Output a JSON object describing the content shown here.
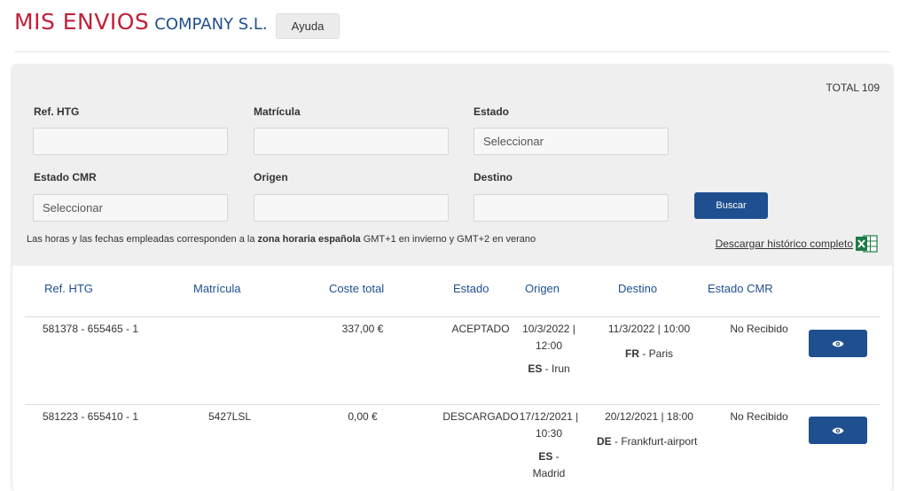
{
  "header": {
    "brand_main": "MIS ENVIOS",
    "brand_sub": "COMPANY S.L.",
    "help_label": "Ayuda"
  },
  "filters": {
    "total": "TOTAL 109",
    "ref_label": "Ref. HTG",
    "ref_value": "",
    "matricula_label": "Matrícula",
    "matricula_value": "",
    "estado_label": "Estado",
    "estado_value": "Seleccionar",
    "estado_cmr_label": "Estado CMR",
    "estado_cmr_value": "Seleccionar",
    "origen_label": "Origen",
    "origen_value": "",
    "destino_label": "Destino",
    "destino_value": "",
    "search_label": "Buscar",
    "note_prefix": "Las horas y las fechas empleadas corresponden a la ",
    "note_bold": "zona horaria española",
    "note_suffix": " GMT+1 en invierno y GMT+2 en verano",
    "download_label": "Descargar histórico completo"
  },
  "table": {
    "columns": [
      "Ref. HTG",
      "Matrícula",
      "Coste total",
      "Estado",
      "Origen",
      "Destino",
      "Estado CMR"
    ],
    "rows": [
      {
        "ref": "581378 - 655465 - 1",
        "matricula": "",
        "coste": "337,00 €",
        "estado": "ACEPTADO",
        "origen_date": "10/3/2022 |",
        "origen_time": "12:00",
        "origen_country": "ES",
        "origen_city": " - Irun",
        "destino_datetime": "11/3/2022 | 10:00",
        "destino_country": "FR",
        "destino_city": " - Paris",
        "cmr": "No Recibido"
      },
      {
        "ref": "581223 - 655410 - 1",
        "matricula": "5427LSL",
        "coste": "0,00 €",
        "estado": "DESCARGADO",
        "origen_date": "17/12/2021 |",
        "origen_time": "10:30",
        "origen_country": "ES",
        "origen_city": " -",
        "origen_city2": "Madrid",
        "destino_datetime": "20/12/2021 | 18:00",
        "destino_country": "DE",
        "destino_city": " - Frankfurt-airport",
        "cmr": "No Recibido"
      }
    ]
  },
  "colors": {
    "brand_red": "#c0213a",
    "brand_blue": "#1f4f8f",
    "excel_green": "#1e7b45"
  },
  "icons": {
    "view": "eye-icon",
    "excel": "excel-icon"
  }
}
